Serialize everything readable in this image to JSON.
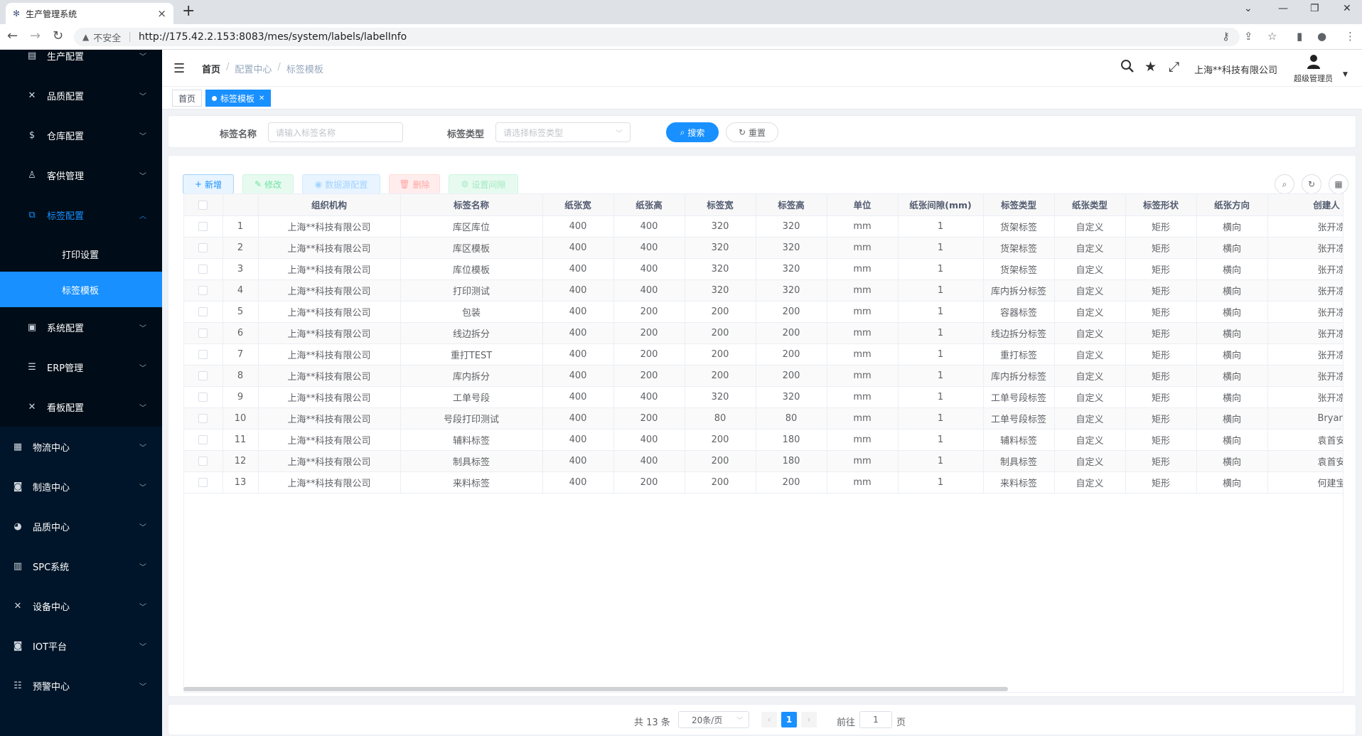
{
  "browser": {
    "tab_title": "生产管理系统",
    "security_label": "不安全",
    "url": "http://175.42.2.153:8083/mes/system/labels/labelInfo"
  },
  "sidebar": {
    "sub_items": [
      {
        "label": "生产配置",
        "icon": "layout-icon"
      },
      {
        "label": "品质配置",
        "icon": "tools-icon"
      },
      {
        "label": "仓库配置",
        "icon": "dollar-icon"
      },
      {
        "label": "客供管理",
        "icon": "user-icon"
      },
      {
        "label": "标签配置",
        "icon": "copy-icon"
      }
    ],
    "leaf_items": [
      {
        "label": "打印设置"
      },
      {
        "label": "标签模板"
      }
    ],
    "after_items": [
      {
        "label": "系统配置",
        "icon": "monitor-icon"
      },
      {
        "label": "ERP管理",
        "icon": "sliders-icon"
      },
      {
        "label": "看板配置",
        "icon": "tools-icon"
      }
    ],
    "top_items": [
      {
        "label": "物流中心",
        "icon": "grid-icon"
      },
      {
        "label": "制造中心",
        "icon": "chip-icon"
      },
      {
        "label": "品质中心",
        "icon": "dashboard-icon"
      },
      {
        "label": "SPC系统",
        "icon": "chart-icon"
      },
      {
        "label": "设备中心",
        "icon": "tools-icon"
      },
      {
        "label": "IOT平台",
        "icon": "chip-icon"
      },
      {
        "label": "预警中心",
        "icon": "list-icon"
      }
    ]
  },
  "header": {
    "breadcrumb": [
      "首页",
      "配置中心",
      "标签模板"
    ],
    "company": "上海**科技有限公司",
    "role": "超级管理员"
  },
  "tagsview": {
    "tags": [
      "首页",
      "标签模板"
    ]
  },
  "search": {
    "name_label": "标签名称",
    "name_placeholder": "请输入标签名称",
    "type_label": "标签类型",
    "type_placeholder": "请选择标签类型",
    "search_btn": "搜索",
    "reset_btn": "重置"
  },
  "toolbar": {
    "add": "新增",
    "edit": "修改",
    "datasource": "数据源配置",
    "delete": "删除",
    "gap": "设置间隙"
  },
  "table": {
    "columns": [
      "组织机构",
      "标签名称",
      "纸张宽",
      "纸张高",
      "标签宽",
      "标签高",
      "单位",
      "纸张间隙(mm)",
      "标签类型",
      "纸张类型",
      "标签形状",
      "纸张方向",
      "创建人"
    ],
    "rows": [
      [
        "1",
        "上海**科技有限公司",
        "库区库位",
        "400",
        "400",
        "320",
        "320",
        "mm",
        "1",
        "货架标签",
        "自定义",
        "矩形",
        "横向",
        "张开凉"
      ],
      [
        "2",
        "上海**科技有限公司",
        "库区模板",
        "400",
        "400",
        "320",
        "320",
        "mm",
        "1",
        "货架标签",
        "自定义",
        "矩形",
        "横向",
        "张开凉"
      ],
      [
        "3",
        "上海**科技有限公司",
        "库位模板",
        "400",
        "400",
        "320",
        "320",
        "mm",
        "1",
        "货架标签",
        "自定义",
        "矩形",
        "横向",
        "张开凉"
      ],
      [
        "4",
        "上海**科技有限公司",
        "打印测试",
        "400",
        "400",
        "320",
        "320",
        "mm",
        "1",
        "库内拆分标签",
        "自定义",
        "矩形",
        "横向",
        "张开凉"
      ],
      [
        "5",
        "上海**科技有限公司",
        "包装",
        "400",
        "200",
        "200",
        "200",
        "mm",
        "1",
        "容器标签",
        "自定义",
        "矩形",
        "横向",
        "张开凉"
      ],
      [
        "6",
        "上海**科技有限公司",
        "线边拆分",
        "400",
        "200",
        "200",
        "200",
        "mm",
        "1",
        "线边拆分标签",
        "自定义",
        "矩形",
        "横向",
        "张开凉"
      ],
      [
        "7",
        "上海**科技有限公司",
        "重打TEST",
        "400",
        "200",
        "200",
        "200",
        "mm",
        "1",
        "重打标签",
        "自定义",
        "矩形",
        "横向",
        "张开凉"
      ],
      [
        "8",
        "上海**科技有限公司",
        "库内拆分",
        "400",
        "200",
        "200",
        "200",
        "mm",
        "1",
        "库内拆分标签",
        "自定义",
        "矩形",
        "横向",
        "张开凉"
      ],
      [
        "9",
        "上海**科技有限公司",
        "工单号段",
        "400",
        "400",
        "320",
        "320",
        "mm",
        "1",
        "工单号段标签",
        "自定义",
        "矩形",
        "横向",
        "张开凉"
      ],
      [
        "10",
        "上海**科技有限公司",
        "号段打印测试",
        "400",
        "200",
        "80",
        "80",
        "mm",
        "1",
        "工单号段标签",
        "自定义",
        "矩形",
        "横向",
        "Bryan"
      ],
      [
        "11",
        "上海**科技有限公司",
        "辅料标签",
        "400",
        "400",
        "200",
        "180",
        "mm",
        "1",
        "辅料标签",
        "自定义",
        "矩形",
        "横向",
        "袁首安"
      ],
      [
        "12",
        "上海**科技有限公司",
        "制具标签",
        "400",
        "400",
        "200",
        "180",
        "mm",
        "1",
        "制具标签",
        "自定义",
        "矩形",
        "横向",
        "袁首安"
      ],
      [
        "13",
        "上海**科技有限公司",
        "来料标签",
        "400",
        "200",
        "200",
        "200",
        "mm",
        "1",
        "来料标签",
        "自定义",
        "矩形",
        "横向",
        "何建宝"
      ]
    ]
  },
  "pagination": {
    "total": "共 13 条",
    "page_size": "20条/页",
    "current": "1",
    "goto_label": "前往",
    "goto_value": "1",
    "page_suffix": "页"
  },
  "colors": {
    "sidebar_bg": "#001529",
    "accent": "#1890ff"
  }
}
